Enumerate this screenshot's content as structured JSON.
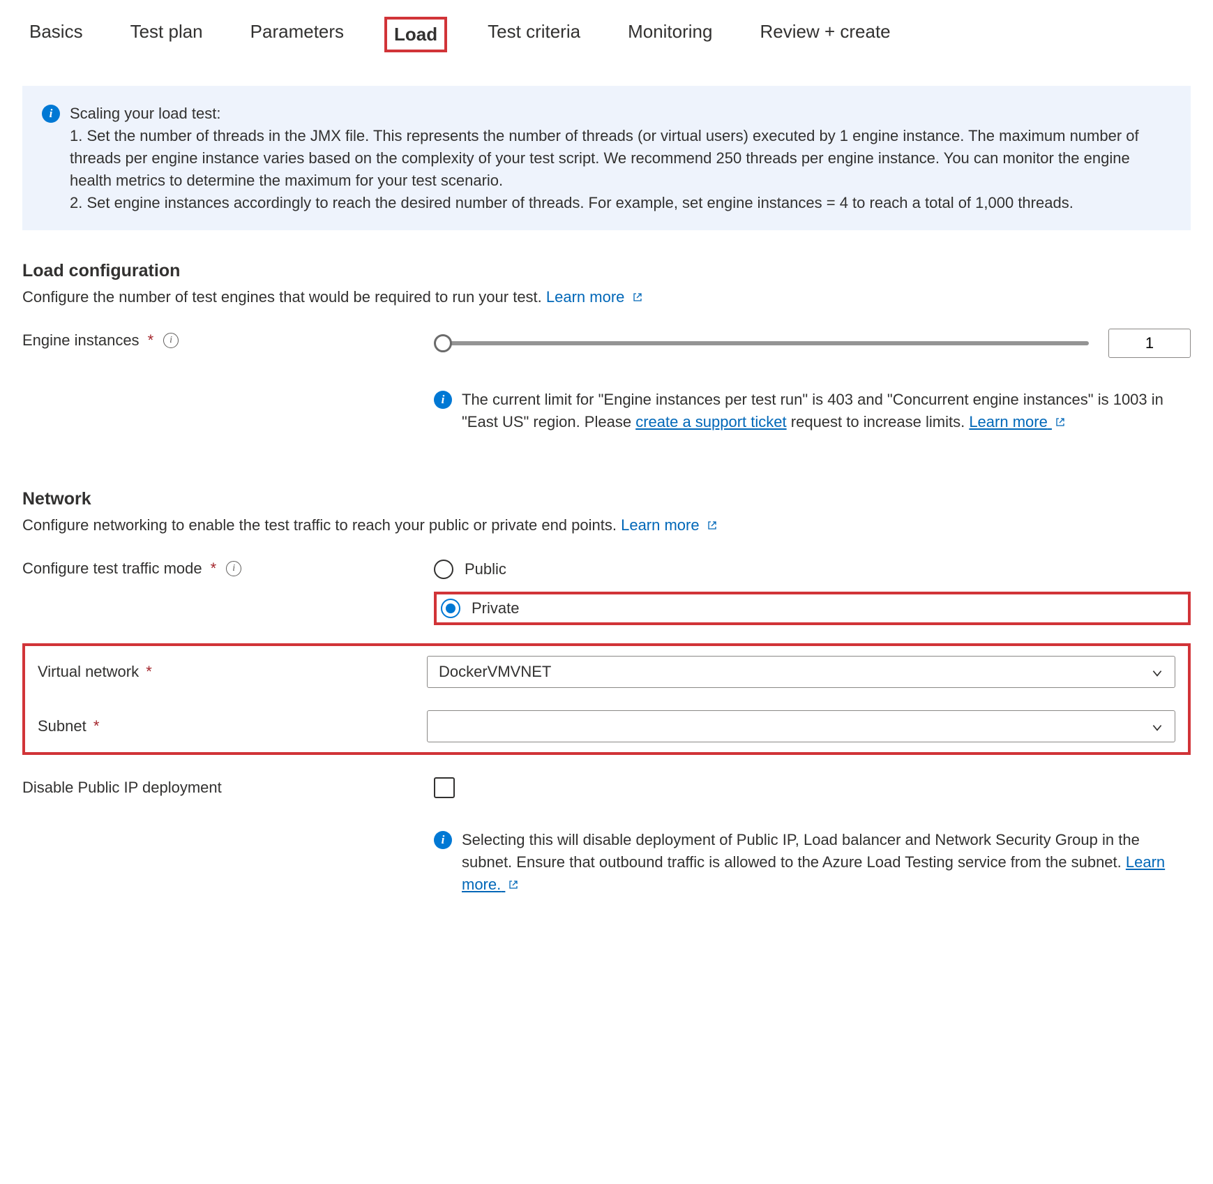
{
  "tabs": {
    "basics": "Basics",
    "testplan": "Test plan",
    "parameters": "Parameters",
    "load": "Load",
    "testcriteria": "Test criteria",
    "monitoring": "Monitoring",
    "reviewcreate": "Review + create"
  },
  "info": {
    "title": "Scaling your load test:",
    "line1": "1. Set the number of threads in the JMX file. This represents the number of threads (or virtual users) executed by 1 engine instance. The maximum number of threads per engine instance varies based on the complexity of your test script. We recommend 250 threads per engine instance. You can monitor the engine health metrics to determine the maximum for your test scenario.",
    "line2": "2. Set engine instances accordingly to reach the desired number of threads. For example, set engine instances = 4 to reach a total of 1,000 threads."
  },
  "loadconfig": {
    "title": "Load configuration",
    "desc": "Configure the number of test engines that would be required to run your test. ",
    "learnmore": "Learn more",
    "engine_label": "Engine instances",
    "engine_value": "1",
    "limit_part1": "The current limit for \"Engine instances per test run\" is 403 and \"Concurrent engine instances\" is 1003 in \"East US\" region. Please ",
    "limit_link1": "create a support ticket",
    "limit_part2": " request to increase limits. ",
    "limit_link2": "Learn more"
  },
  "network": {
    "title": "Network",
    "desc": "Configure networking to enable the test traffic to reach your public or private end points. ",
    "learnmore": "Learn more",
    "traffic_mode_label": "Configure test traffic mode",
    "radio_public": "Public",
    "radio_private": "Private",
    "vnet_label": "Virtual network",
    "vnet_value": "DockerVMVNET",
    "subnet_label": "Subnet",
    "subnet_value": "",
    "disable_ip_label": "Disable Public IP deployment",
    "disable_ip_note": "Selecting this will disable deployment of Public IP, Load balancer and Network Security Group in the subnet. Ensure that outbound traffic is allowed to the Azure Load Testing service from the subnet. ",
    "disable_ip_link": "Learn more."
  }
}
